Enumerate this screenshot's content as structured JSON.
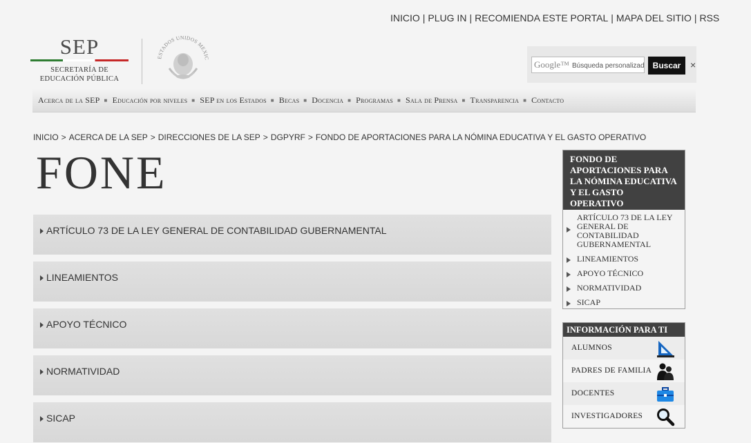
{
  "top_links": [
    "INICIO",
    "PLUG IN",
    "RECOMIENDA ESTE PORTAL",
    "MAPA DEL SITIO",
    "RSS"
  ],
  "logo": {
    "title": "SEP",
    "subtitle_line1": "SECRETARÍA DE",
    "subtitle_line2": "EDUCACIÓN PÚBLICA",
    "seal_text": "ESTADOS UNIDOS MEXICANOS"
  },
  "search": {
    "google_label": "Google™",
    "placeholder": "Búsqueda personalizada",
    "button": "Buscar",
    "close": "×"
  },
  "nav": [
    "Acerca de la SEP",
    "Educación por niveles",
    "SEP en los Estados",
    "Becas",
    "Docencia",
    "Programas",
    "Sala de Prensa",
    "Transparencia",
    "Contacto"
  ],
  "breadcrumb": [
    "INICIO",
    "ACERCA DE LA SEP",
    "DIRECCIONES DE LA SEP",
    "DGPYRF",
    "FONDO DE APORTACIONES PARA LA NÓMINA EDUCATIVA Y EL GASTO OPERATIVO"
  ],
  "page_title": "FONE",
  "accordion": [
    "ARTÍCULO 73 DE LA LEY GENERAL DE CONTABILIDAD GUBERNAMENTAL",
    "LINEAMIENTOS",
    "APOYO TÉCNICO",
    "NORMATIVIDAD",
    "SICAP"
  ],
  "side_menu": {
    "heading_lines": [
      "FONDO DE",
      "APORTACIONES PARA",
      "LA NÓMINA EDUCATIVA",
      "Y EL GASTO",
      "OPERATIVO"
    ],
    "items": [
      "ARTÍCULO 73 DE LA LEY GENERAL DE CONTABILIDAD GUBERNAMENTAL",
      "LINEAMIENTOS",
      "APOYO TÉCNICO",
      "NORMATIVIDAD",
      "SICAP"
    ]
  },
  "info_para_ti": {
    "heading": "INFORMACIÓN PARA TI",
    "items": [
      {
        "label": "ALUMNOS",
        "icon": "drafting-triangle-icon"
      },
      {
        "label": "PADRES DE FAMILIA",
        "icon": "parents-icon"
      },
      {
        "label": "DOCENTES",
        "icon": "briefcase-icon"
      },
      {
        "label": "INVESTIGADORES",
        "icon": "magnifier-icon"
      }
    ]
  }
}
